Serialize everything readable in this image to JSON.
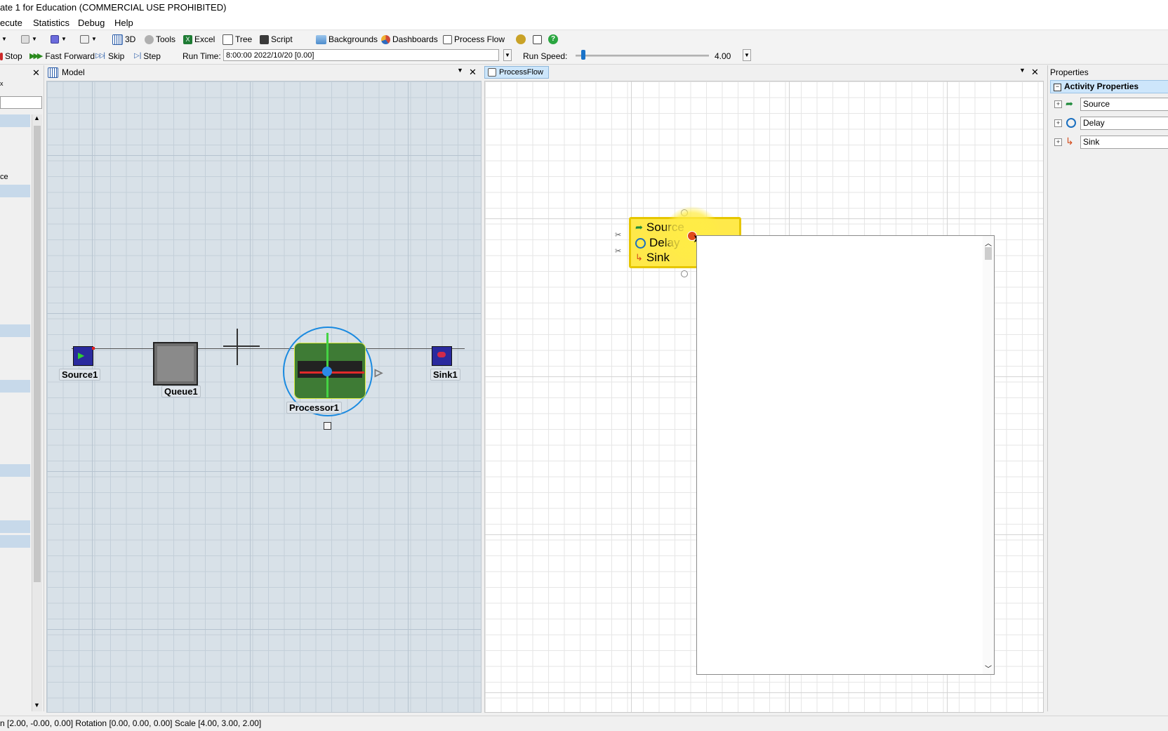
{
  "window": {
    "title": "ate 1 for Education (COMMERCIAL USE PROHIBITED)"
  },
  "menu": [
    "ecute",
    "Statistics",
    "Debug",
    "Help"
  ],
  "toolbar": {
    "view3d": "3D",
    "tools": "Tools",
    "excel": "Excel",
    "tree": "Tree",
    "script": "Script",
    "backgrounds": "Backgrounds",
    "dashboards": "Dashboards",
    "process_flow": "Process Flow"
  },
  "runbar": {
    "stop": "Stop",
    "fast_forward": "Fast Forward",
    "skip": "Skip",
    "step": "Step",
    "run_time_label": "Run Time:",
    "run_time_value": "8:00:00  2022/10/20  [0.00]",
    "run_speed_label": "Run Speed:",
    "run_speed_value": "4.00",
    "run_speed_fraction": 0.02
  },
  "left_panel": {
    "partial_label": "ce"
  },
  "model_tab": {
    "title": "Model",
    "objects": {
      "source": "Source1",
      "queue": "Queue1",
      "processor": "Processor1",
      "sink": "Sink1"
    }
  },
  "processflow_tab": {
    "title": "ProcessFlow",
    "activities": [
      "Source",
      "Delay",
      "Sink"
    ]
  },
  "properties": {
    "header": "Properties",
    "section": "Activity Properties",
    "rows": [
      "Source",
      "Delay",
      "Sink"
    ]
  },
  "status": {
    "text": "n [2.00, -0.00, 0.00]  Rotation [0.00, 0.00, 0.00]  Scale [4.00, 3.00, 2.00]"
  },
  "colors": {
    "accent": "#1a73c9",
    "selection_yellow": "#ffe94a",
    "model_bg": "#d8e1e8",
    "tab_active": "#cde6fb"
  }
}
